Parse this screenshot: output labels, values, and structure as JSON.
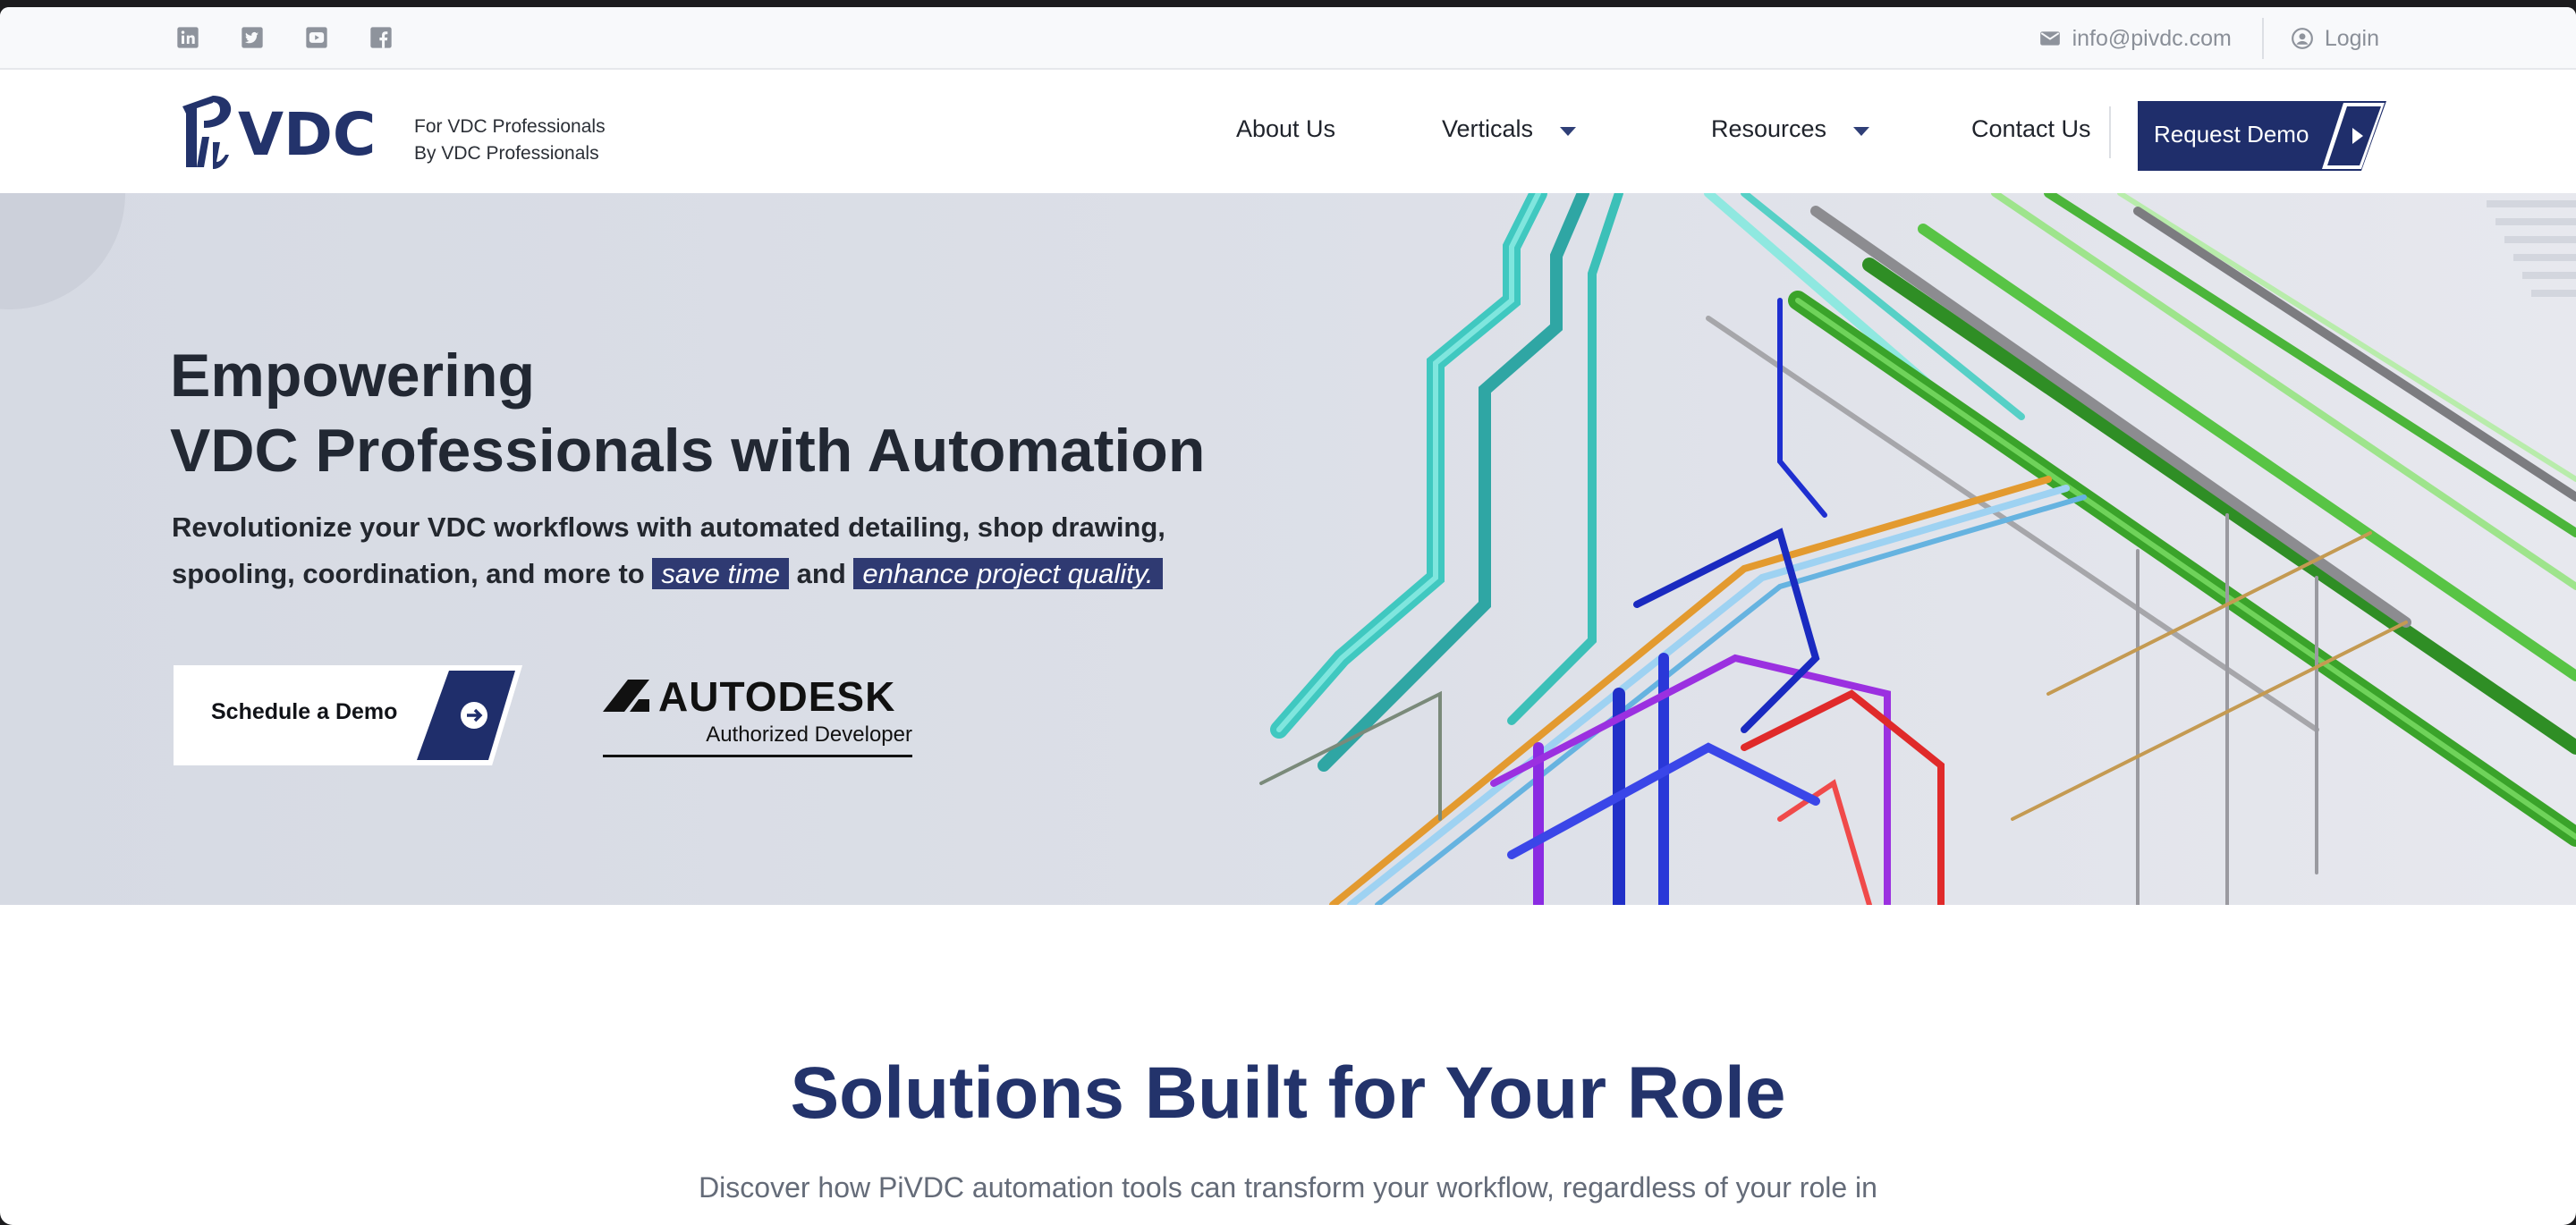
{
  "utility_bar": {
    "social_icons": [
      "linkedin-icon",
      "twitter-icon",
      "youtube-icon",
      "facebook-icon"
    ],
    "email": "info@pivdc.com",
    "login": "Login"
  },
  "header": {
    "logo_text": "PiVDC",
    "tagline_line1": "For VDC Professionals",
    "tagline_line2": "By VDC Professionals",
    "nav": {
      "about": "About Us",
      "verticals": "Verticals",
      "resources": "Resources",
      "contact": "Contact Us"
    },
    "cta": "Request Demo"
  },
  "hero": {
    "title_line1": "Empowering",
    "title_line2": "VDC Professionals with Automation",
    "subtitle_part1": "Revolutionize your VDC workflows with automated detailing, shop drawing, spooling, coordination, and more to",
    "highlight1": "save time",
    "subtitle_and": "and",
    "highlight2": "enhance project quality.",
    "schedule_button": "Schedule a Demo",
    "autodesk_wordmark": "AUTODESK",
    "autodesk_sub": "Authorized Developer"
  },
  "solutions": {
    "title": "Solutions Built for Your Role",
    "subtitle": "Discover how PiVDC automation tools can transform your workflow, regardless of your role in"
  },
  "colors": {
    "brand_navy": "#23336b",
    "button_navy": "#1f2e6b",
    "hero_bg": "#d9dce5"
  }
}
